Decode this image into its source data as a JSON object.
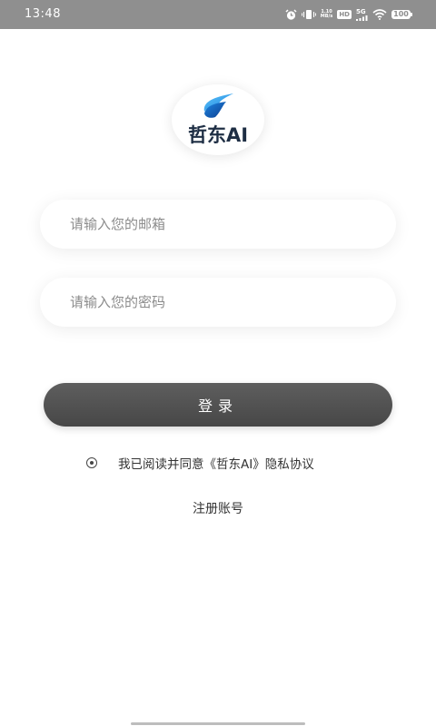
{
  "status_bar": {
    "time": "13:48",
    "speed_value": "1.10",
    "speed_unit": "MB/s",
    "hd_label": "HD",
    "network_label": "5G",
    "battery_level": "100",
    "icons": [
      "alarm-icon",
      "vibrate-icon",
      "signal-icon",
      "wifi-icon",
      "battery-icon"
    ]
  },
  "logo": {
    "text": "哲东AI",
    "colors": {
      "accent_light": "#5bc0f5",
      "accent_dark": "#1565c0",
      "text": "#1e2e44"
    }
  },
  "form": {
    "email_placeholder": "请输入您的邮箱",
    "email_value": "",
    "password_placeholder": "请输入您的密码",
    "password_value": ""
  },
  "login_button": {
    "label": "登录"
  },
  "agreement": {
    "text": "我已阅读并同意《哲东AI》隐私协议"
  },
  "register": {
    "label": "注册账号"
  }
}
